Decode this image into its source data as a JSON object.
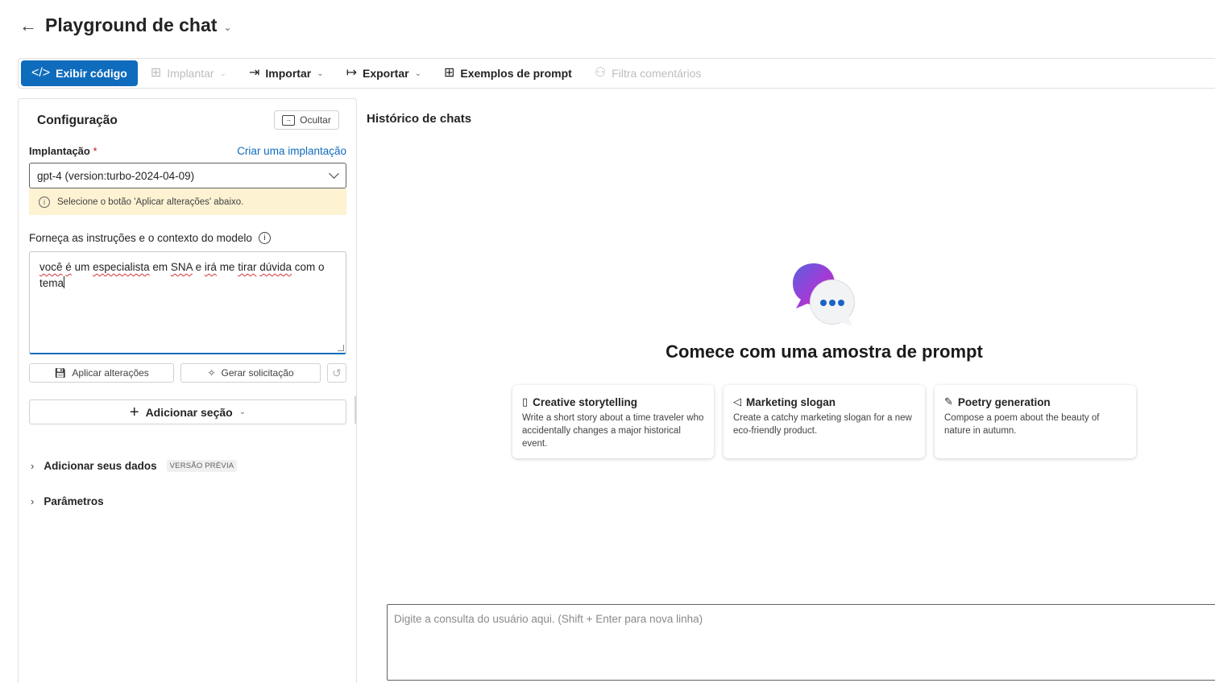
{
  "header": {
    "back_icon": "arrow-left-icon",
    "title": "Playground de chat"
  },
  "toolbar": {
    "view_code": "Exibir código",
    "deploy": "Implantar",
    "import": "Importar",
    "export": "Exportar",
    "prompt_samples": "Exemplos de prompt",
    "filter_comments": "Filtra comentários"
  },
  "config": {
    "title": "Configuração",
    "hide_label": "Ocultar",
    "deployment_label": "Implantação",
    "required_mark": "*",
    "create_deployment_link": "Criar uma implantação",
    "deployment_value": "gpt-4 (version:turbo-2024-04-09)",
    "warning_text": "Selecione o botão 'Aplicar alterações' abaixo.",
    "instructions_label": "Forneça as instruções e o contexto do modelo",
    "instructions_words": {
      "w1": "você",
      "w2": "é",
      "w3": " um ",
      "w4": "especialista",
      "w5": " em ",
      "w6": "SNA",
      "w7": " e ",
      "w8": "irá",
      "w9": " me ",
      "w10": "tirar",
      "w11": " ",
      "w12": "dúvida",
      "w13": " com o tema"
    },
    "apply_label": "Aplicar alterações",
    "generate_label": "Gerar solicitação",
    "add_section_label": "Adicionar seção",
    "add_data_label": "Adicionar seus dados",
    "preview_tag": "VERSÃO PRÉVIA",
    "parameters_label": "Parâmetros"
  },
  "chat": {
    "title": "Histórico de chats",
    "hero_title": "Comece com uma amostra de prompt",
    "cards": [
      {
        "icon": "notebook-icon",
        "title": "Creative storytelling",
        "desc": "Write a short story about a time traveler who accidentally changes a major historical event."
      },
      {
        "icon": "megaphone-icon",
        "title": "Marketing slogan",
        "desc": "Create a catchy marketing slogan for a new eco-friendly product."
      },
      {
        "icon": "pen-icon",
        "title": "Poetry generation",
        "desc": "Compose a poem about the beauty of nature in autumn."
      }
    ],
    "input_placeholder": "Digite a consulta do usuário aqui. (Shift + Enter para nova linha)"
  },
  "colors": {
    "accent": "#0f6cbd",
    "warning_bg": "#fdf3d3",
    "required": "#c50f1f"
  }
}
